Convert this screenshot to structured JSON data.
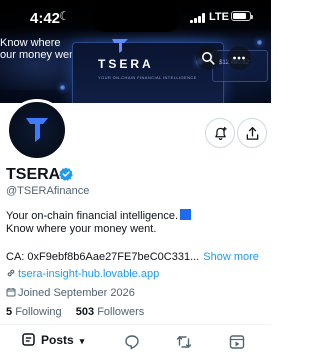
{
  "status_bar": {
    "time": "4:42",
    "network": "LTE"
  },
  "banner": {
    "tagline_line1": "Know where",
    "tagline_line2": "our money went.",
    "wordmark": "TSERA",
    "slogan": "YOUR ON-CHAIN FINANCIAL INTELLIGENCE",
    "card_value": "$12,480.82"
  },
  "profile": {
    "display_name": "TSERA",
    "handle": "@TSERAfinance",
    "bio_line1": "Your on-chain financial intelligence.",
    "bio_line2": "Know where your money went.",
    "contract_line": "CA: 0xF9ebf8b6Aae27FE7beC0C331...",
    "show_more": "Show more",
    "website": "tsera-insight-hub.lovable.app",
    "joined": "Joined September 2026",
    "following_count": "5",
    "following_label": "Following",
    "followers_count": "503",
    "followers_label": "Followers"
  },
  "tabs": {
    "posts_label": "Posts"
  },
  "colors": {
    "accent": "#1d9bf0",
    "banner_dark": "#050b1c",
    "verified_blue": "#1d9bf0"
  }
}
